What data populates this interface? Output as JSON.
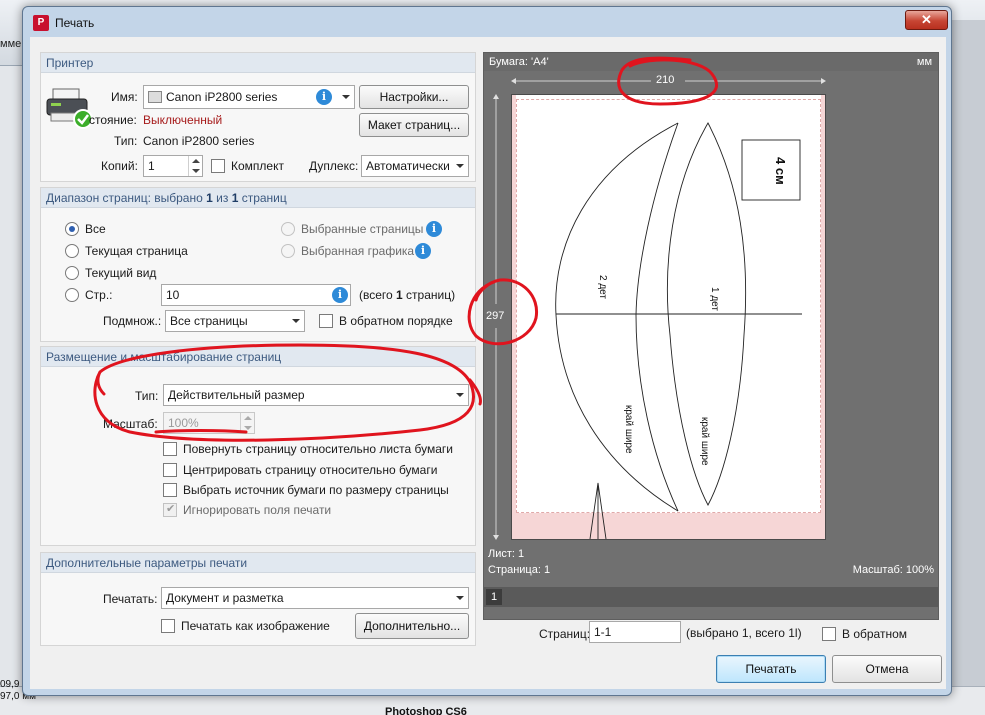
{
  "background": {
    "left_text": "мме",
    "status_1": "09,9",
    "status_2": "97,0 мм",
    "taskbar_item": "Photoshop CS6"
  },
  "dialog": {
    "title": "Печать",
    "close_glyph": "✕"
  },
  "printer": {
    "header": "Принтер",
    "name_label": "Имя:",
    "name_value": "Canon iP2800 series",
    "status_label": "Состояние:",
    "status_label_visible": "стояние:",
    "status_value": "Выключенный",
    "type_label": "Тип:",
    "type_value": "Canon iP2800 series",
    "copies_label": "Копий:",
    "copies_value": "1",
    "collate_label": "Комплект",
    "duplex_label": "Дуплекс:",
    "duplex_value": "Автоматически",
    "settings_button": "Настройки...",
    "layout_button": "Макет страниц..."
  },
  "range": {
    "header_prefix": "Диапазон страниц: выбрано ",
    "header_selected": "1",
    "header_mid": " из ",
    "header_total": "1",
    "header_suffix": " страниц",
    "all": "Все",
    "current_page": "Текущая страница",
    "current_view": "Текущий вид",
    "pages_label": "Стр.:",
    "pages_value": "10",
    "pages_total_prefix": "(всего ",
    "pages_total_value": "1",
    "pages_total_suffix": " страниц)",
    "selected_pages": "Выбранные страницы",
    "selected_graphics": "Выбранная графика",
    "subset_label": "Подмнож.:",
    "subset_value": "Все страницы",
    "reverse_label": "В обратном порядке"
  },
  "placement": {
    "header": "Размещение и масштабирование страниц",
    "type_label": "Тип:",
    "type_value": "Действительный размер",
    "scale_label": "Масштаб:",
    "scale_value": "100%",
    "rotate_label": "Повернуть страницу относительно листа бумаги",
    "center_label": "Центрировать страницу относительно бумаги",
    "source_label": "Выбрать источник бумаги по размеру страницы",
    "ignore_margins_label": "Игнорировать поля печати"
  },
  "extra": {
    "header": "Дополнительные параметры печати",
    "print_label": "Печатать:",
    "print_value": "Документ и разметка",
    "as_image_label": "Печатать как изображение",
    "more_button": "Дополнительно..."
  },
  "preview": {
    "paper_label": "Бумага: 'A4'",
    "units": "мм",
    "width_mm": "210",
    "height_mm": "297",
    "sheet_label": "Лист: 1",
    "page_label": "Страница: 1",
    "scale_label": "Масштаб: 100%",
    "thumb_number": "1",
    "content": {
      "box_text": "4 см",
      "piece_2_label": "2 дет",
      "piece_1_label": "1 дет",
      "edge_wider_left": "край шире",
      "edge_wider_right": "край шире"
    }
  },
  "bottom": {
    "pages_label": "Страниц:",
    "pages_value": "1-1",
    "pages_info": "(выбрано 1, всего 1l)",
    "reverse_label": "В обратном",
    "print_button": "Печатать",
    "cancel_button": "Отмена"
  },
  "annotation_color": "#e0141e"
}
